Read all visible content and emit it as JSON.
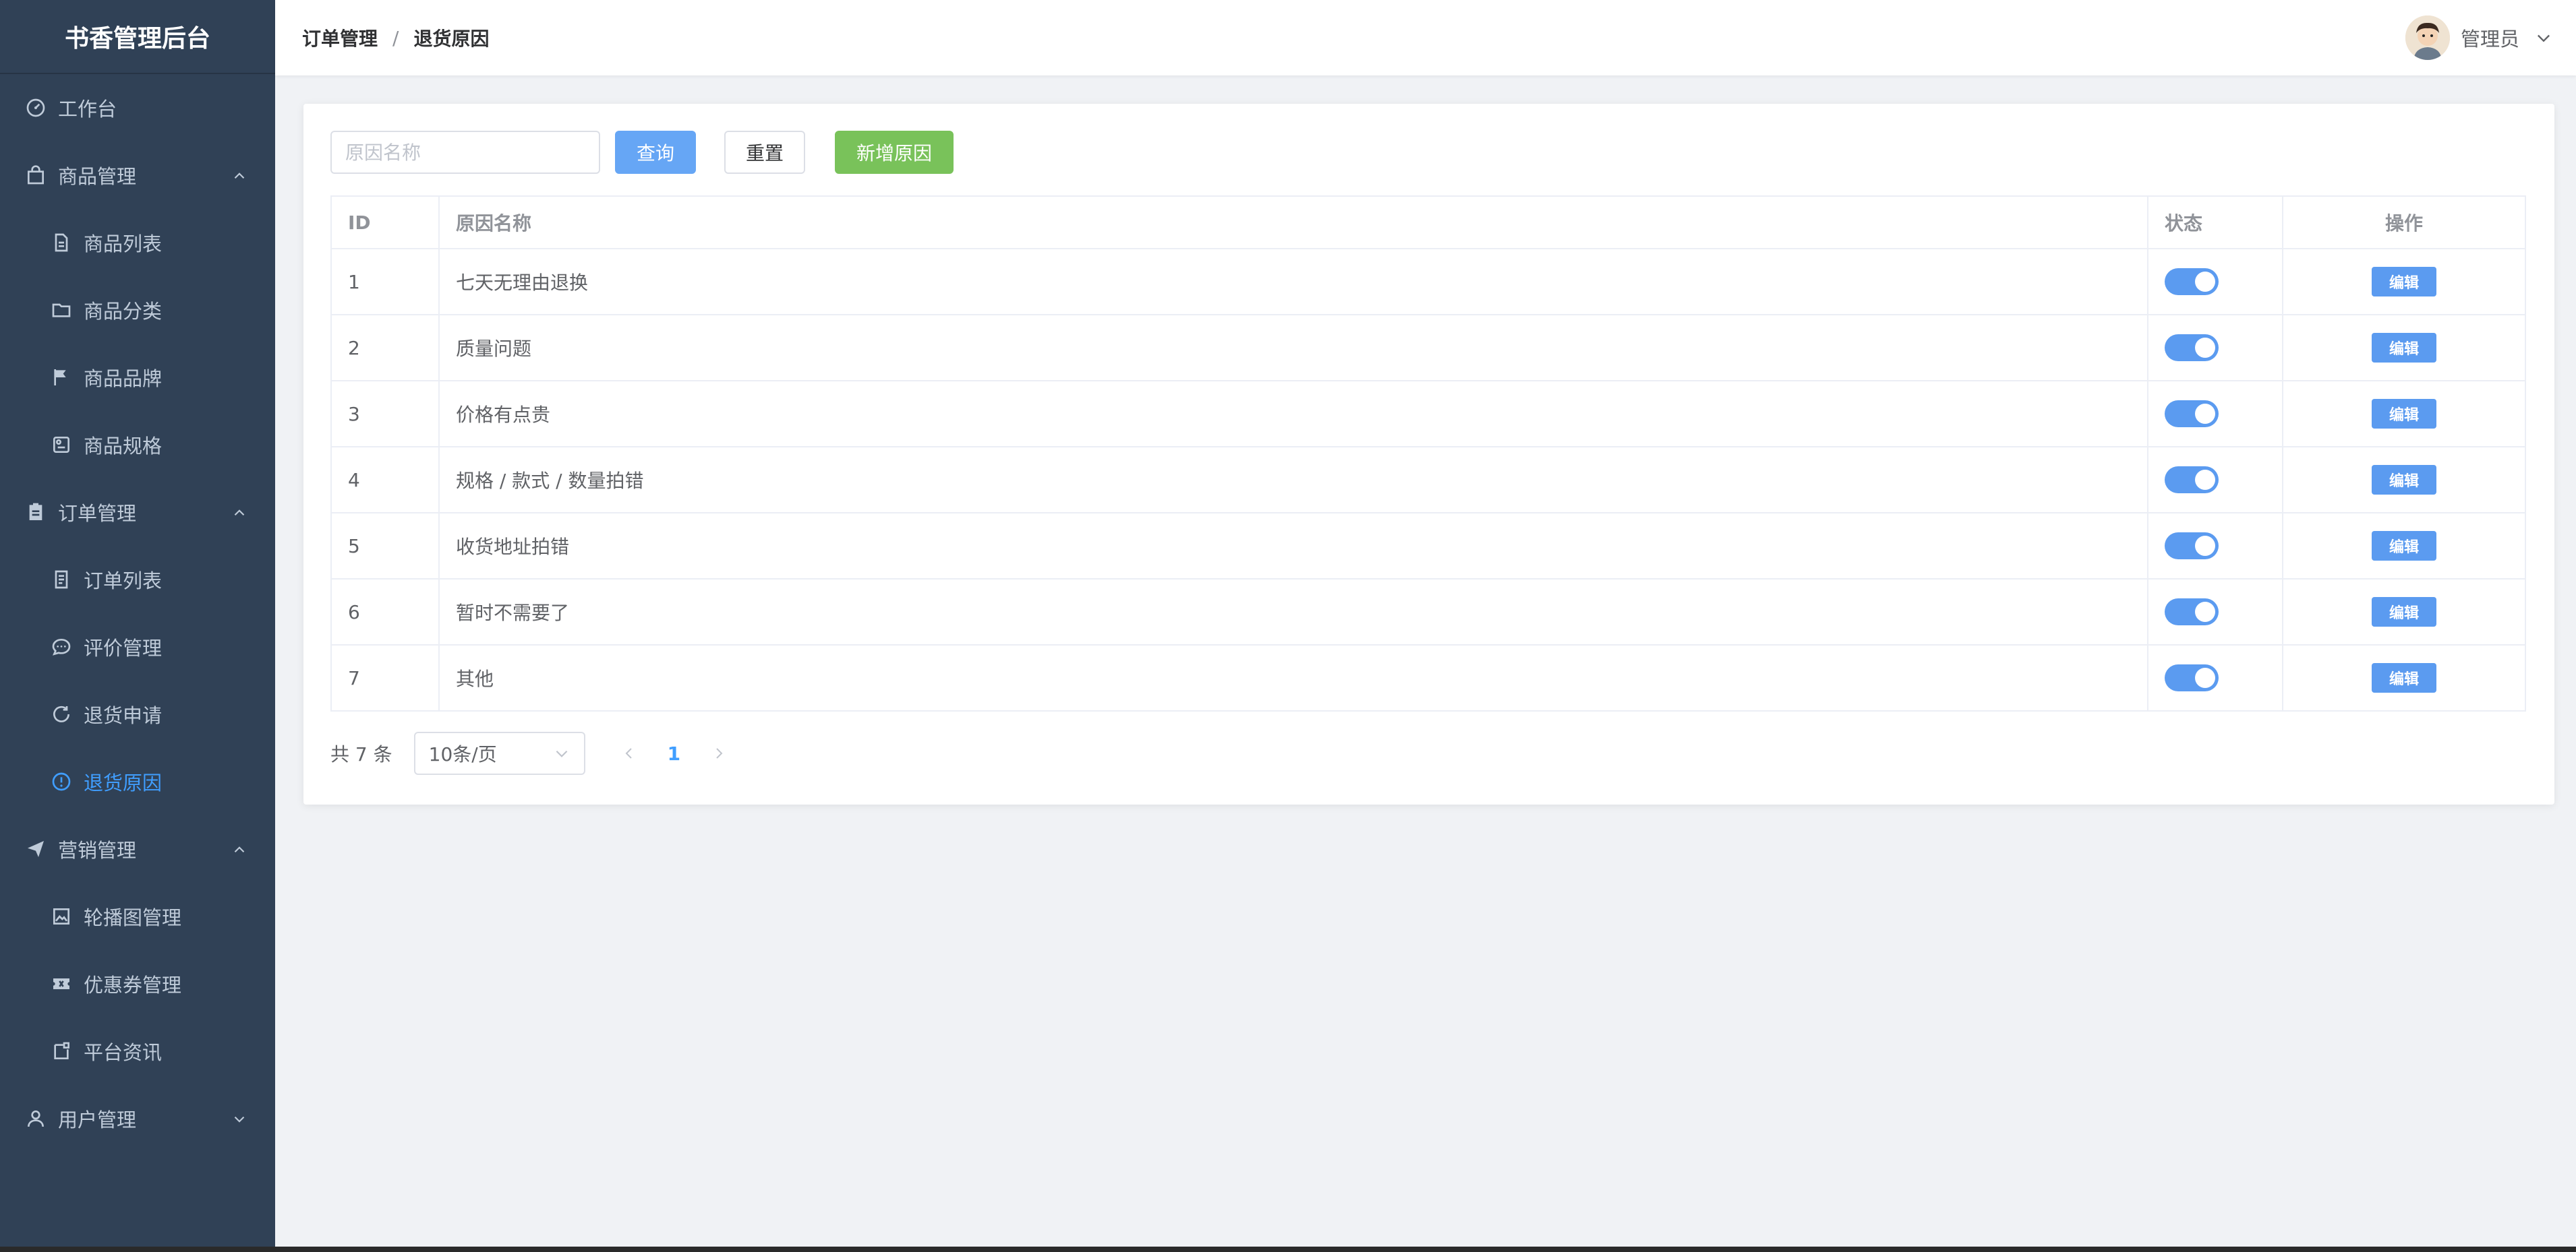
{
  "sidebar": {
    "brand": "书香管理后台",
    "items": [
      {
        "type": "top",
        "label": "工作台",
        "icon": "dashboard-icon"
      },
      {
        "type": "group",
        "label": "商品管理",
        "icon": "shopping-bag-icon",
        "expanded": true
      },
      {
        "type": "sub",
        "label": "商品列表",
        "icon": "document-icon"
      },
      {
        "type": "sub",
        "label": "商品分类",
        "icon": "folder-icon"
      },
      {
        "type": "sub",
        "label": "商品品牌",
        "icon": "flag-icon"
      },
      {
        "type": "sub",
        "label": "商品规格",
        "icon": "tickets-icon"
      },
      {
        "type": "group",
        "label": "订单管理",
        "icon": "clipboard-icon",
        "expanded": true
      },
      {
        "type": "sub",
        "label": "订单列表",
        "icon": "list-icon"
      },
      {
        "type": "sub",
        "label": "评价管理",
        "icon": "chat-icon"
      },
      {
        "type": "sub",
        "label": "退货申请",
        "icon": "refresh-icon"
      },
      {
        "type": "sub",
        "label": "退货原因",
        "icon": "warning-icon",
        "active": true
      },
      {
        "type": "group",
        "label": "营销管理",
        "icon": "send-icon",
        "expanded": true
      },
      {
        "type": "sub",
        "label": "轮播图管理",
        "icon": "picture-icon"
      },
      {
        "type": "sub",
        "label": "优惠券管理",
        "icon": "ticket-icon"
      },
      {
        "type": "sub",
        "label": "平台资讯",
        "icon": "news-icon"
      },
      {
        "type": "group",
        "label": "用户管理",
        "icon": "user-icon",
        "expanded": false
      }
    ]
  },
  "header": {
    "breadcrumb": [
      "订单管理",
      "退货原因"
    ],
    "separator": "/",
    "user_name": "管理员"
  },
  "toolbar": {
    "search_placeholder": "原因名称",
    "search_value": "",
    "query_label": "查询",
    "reset_label": "重置",
    "add_label": "新增原因"
  },
  "table": {
    "columns": [
      "ID",
      "原因名称",
      "状态",
      "操作"
    ],
    "edit_label": "编辑",
    "rows": [
      {
        "id": "1",
        "name": "七天无理由退换",
        "enabled": true
      },
      {
        "id": "2",
        "name": "质量问题",
        "enabled": true
      },
      {
        "id": "3",
        "name": "价格有点贵",
        "enabled": true
      },
      {
        "id": "4",
        "name": "规格 / 款式 / 数量拍错",
        "enabled": true
      },
      {
        "id": "5",
        "name": "收货地址拍错",
        "enabled": true
      },
      {
        "id": "6",
        "name": "暂时不需要了",
        "enabled": true
      },
      {
        "id": "7",
        "name": "其他",
        "enabled": true
      }
    ]
  },
  "pagination": {
    "total_text": "共 7 条",
    "page_size": "10条/页",
    "current_page": "1"
  },
  "colors": {
    "sidebar_bg": "#304156",
    "active": "#409eff",
    "primary_btn": "#66a6f5",
    "success_btn": "#79c25a",
    "switch_on": "#5b9bf0"
  }
}
